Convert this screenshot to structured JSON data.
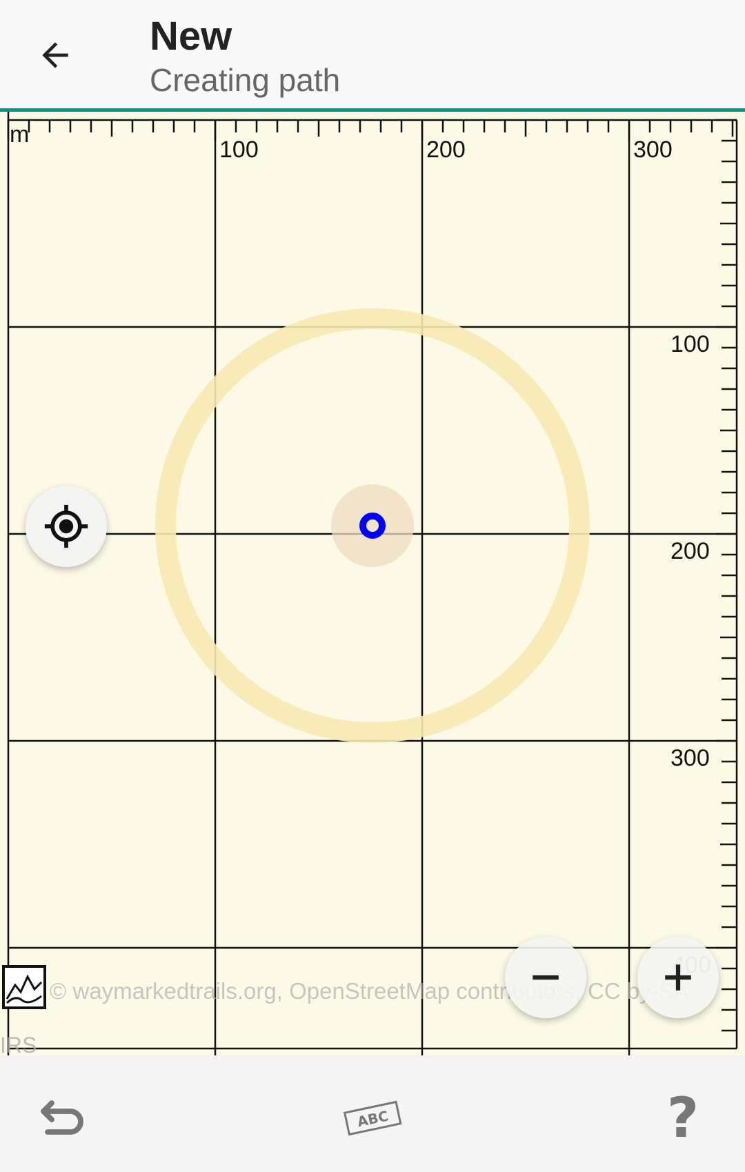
{
  "appbar": {
    "title": "New",
    "subtitle": "Creating path",
    "accent_color": "#009688",
    "back_icon": "arrow-left-icon"
  },
  "map": {
    "background_color": "#fcfae6",
    "unit_label": "m",
    "x_ruler_labels": [
      "100",
      "200",
      "300"
    ],
    "y_ruler_labels": [
      "100",
      "200",
      "300",
      "400"
    ],
    "accuracy_circle_color": "#f7e9b2",
    "position_marker_color": "#0000ff",
    "attribution": "© waymarkedtrails.org, OpenStreetMap contributors, CC by-SA",
    "source_label": "IRS"
  },
  "buttons": {
    "locate_icon": "my-location-icon",
    "zoom_out_icon": "minus-icon",
    "zoom_in_icon": "plus-icon"
  },
  "bottombar": {
    "undo_icon": "undo-icon",
    "label_icon": "abc-label-icon",
    "label_text": "ABC",
    "help_text": "?"
  }
}
